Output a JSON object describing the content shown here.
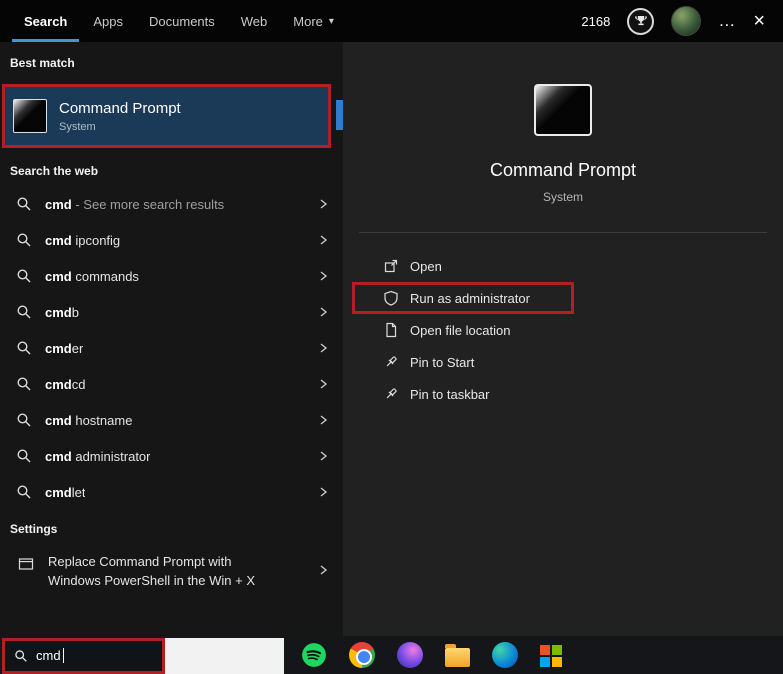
{
  "topbar": {
    "tabs": [
      {
        "label": "Search",
        "active": true
      },
      {
        "label": "Apps",
        "active": false
      },
      {
        "label": "Documents",
        "active": false
      },
      {
        "label": "Web",
        "active": false
      },
      {
        "label": "More",
        "active": false,
        "has_dropdown": true
      }
    ],
    "more_caret": "▾",
    "score": "2168",
    "ellipsis": "…",
    "close": "×"
  },
  "left": {
    "best_match_header": "Best match",
    "best_match": {
      "title": "Command Prompt",
      "subtitle": "System",
      "icon": "command-prompt-icon",
      "selected": true,
      "annotated": true
    },
    "web_header": "Search the web",
    "suggestions": [
      {
        "query": "cmd",
        "rest": " - See more search results",
        "dim": true
      },
      {
        "query": "cmd",
        "rest": " ipconfig"
      },
      {
        "query": "cmd",
        "rest": " commands"
      },
      {
        "query": "cmd",
        "rest": "b"
      },
      {
        "query": "cmd",
        "rest": "er"
      },
      {
        "query": "cmd",
        "rest": "cd"
      },
      {
        "query": "cmd",
        "rest": " hostname"
      },
      {
        "query": "cmd",
        "rest": " administrator"
      },
      {
        "query": "cmd",
        "rest": "let"
      }
    ],
    "settings_header": "Settings",
    "settings_item": {
      "line1": "Replace Command Prompt with",
      "line2": "Windows PowerShell in the Win + X",
      "icon": "window-icon"
    }
  },
  "right": {
    "title": "Command Prompt",
    "subtitle": "System",
    "icon": "command-prompt-icon",
    "actions": [
      {
        "label": "Open",
        "icon": "open-window-icon"
      },
      {
        "label": "Run as administrator",
        "icon": "shield-icon",
        "annotated": true
      },
      {
        "label": "Open file location",
        "icon": "document-icon"
      },
      {
        "label": "Pin to Start",
        "icon": "pin-icon"
      },
      {
        "label": "Pin to taskbar",
        "icon": "pin-icon"
      }
    ]
  },
  "taskbar": {
    "search_value": "cmd",
    "app_icons": [
      "spotify",
      "chrome",
      "media-app",
      "file-explorer",
      "edge",
      "microsoft-app"
    ]
  },
  "colors": {
    "accent_blue": "#3a96dd",
    "annotation_red": "#b21f24",
    "selection_blue": "#1b3a57",
    "panel_left": "#161616",
    "panel_right": "#212121",
    "taskbar": "#14161a"
  }
}
